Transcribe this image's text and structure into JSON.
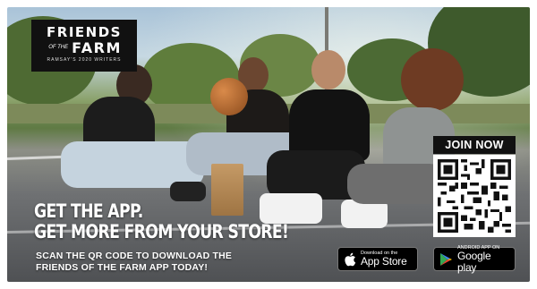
{
  "logo": {
    "line1": "FRIENDS",
    "of_the": "OF THE",
    "line2": "FARM",
    "tagline": "RAMSAY'S 2020 WRITERS"
  },
  "headline": {
    "line1": "Get the app.",
    "line2": "Get more from your store!"
  },
  "subtext": {
    "line1": "Scan the QR code to download the",
    "line2": "Friends of the Farm app today!"
  },
  "qr": {
    "label": "JOIN NOW",
    "icon": "qr-code-icon"
  },
  "badges": {
    "apple": {
      "small": "Download on the",
      "big": "App Store",
      "icon": "apple-icon"
    },
    "google": {
      "small": "ANDROID APP ON",
      "big": "Google play",
      "icon": "google-play-icon"
    }
  },
  "colors": {
    "badge_bg": "#000000",
    "logo_bg": "#111111",
    "text": "#ffffff"
  }
}
